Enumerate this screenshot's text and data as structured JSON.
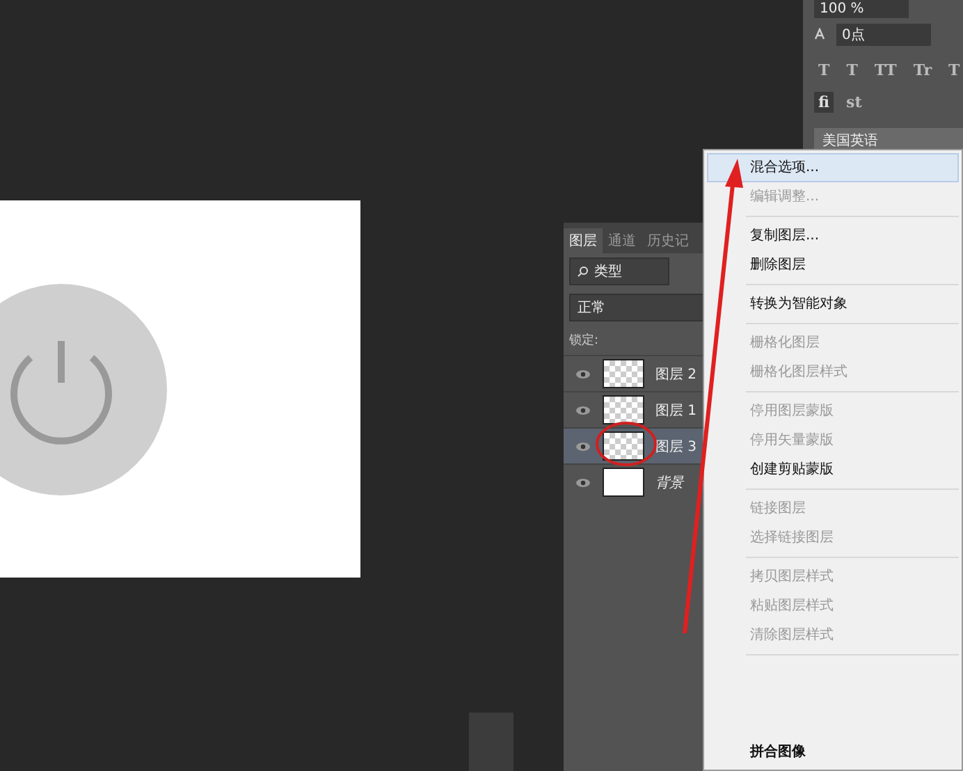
{
  "character_panel": {
    "size": "100 %",
    "tracking": "0点",
    "style_glyphs": [
      "T",
      "T",
      "TT",
      "Tr",
      "T"
    ],
    "opentype_glyphs": [
      {
        "label": "fi",
        "selected": true
      },
      {
        "label": "st",
        "selected": false
      }
    ],
    "language": "美国英语"
  },
  "layers_panel": {
    "tabs": [
      {
        "label": "图层",
        "selected": true
      },
      {
        "label": "通道",
        "selected": false
      },
      {
        "label": "历史记",
        "selected": false
      }
    ],
    "filter": "类型",
    "blend_mode": "正常",
    "lock_label": "锁定:",
    "layers": [
      {
        "name": "图层 2",
        "kind": "transparent",
        "selected": false,
        "visible": true,
        "italic": false
      },
      {
        "name": "图层 1",
        "kind": "transparent",
        "selected": false,
        "visible": true,
        "italic": false
      },
      {
        "name": "图层 3",
        "kind": "transparent",
        "selected": true,
        "visible": true,
        "italic": false
      },
      {
        "name": "背景",
        "kind": "white",
        "selected": false,
        "visible": true,
        "italic": true
      }
    ]
  },
  "context_menu": {
    "groups": [
      [
        {
          "label": "混合选项...",
          "disabled": false,
          "selected": true
        },
        {
          "label": "编辑调整...",
          "disabled": true,
          "selected": false
        }
      ],
      [
        {
          "label": "复制图层...",
          "disabled": false,
          "selected": false
        },
        {
          "label": "删除图层",
          "disabled": false,
          "selected": false
        }
      ],
      [
        {
          "label": "转换为智能对象",
          "disabled": false,
          "selected": false
        }
      ],
      [
        {
          "label": "栅格化图层",
          "disabled": true,
          "selected": false
        },
        {
          "label": "栅格化图层样式",
          "disabled": true,
          "selected": false
        }
      ],
      [
        {
          "label": "停用图层蒙版",
          "disabled": true,
          "selected": false
        },
        {
          "label": "停用矢量蒙版",
          "disabled": true,
          "selected": false
        },
        {
          "label": "创建剪贴蒙版",
          "disabled": false,
          "selected": false
        }
      ],
      [
        {
          "label": "链接图层",
          "disabled": true,
          "selected": false
        },
        {
          "label": "选择链接图层",
          "disabled": true,
          "selected": false
        }
      ],
      [
        {
          "label": "拷贝图层样式",
          "disabled": true,
          "selected": false
        },
        {
          "label": "粘贴图层样式",
          "disabled": true,
          "selected": false
        },
        {
          "label": "清除图层样式",
          "disabled": true,
          "selected": false
        }
      ]
    ],
    "bottom_item": {
      "label": "拼合图像",
      "disabled": false,
      "selected": false
    }
  }
}
